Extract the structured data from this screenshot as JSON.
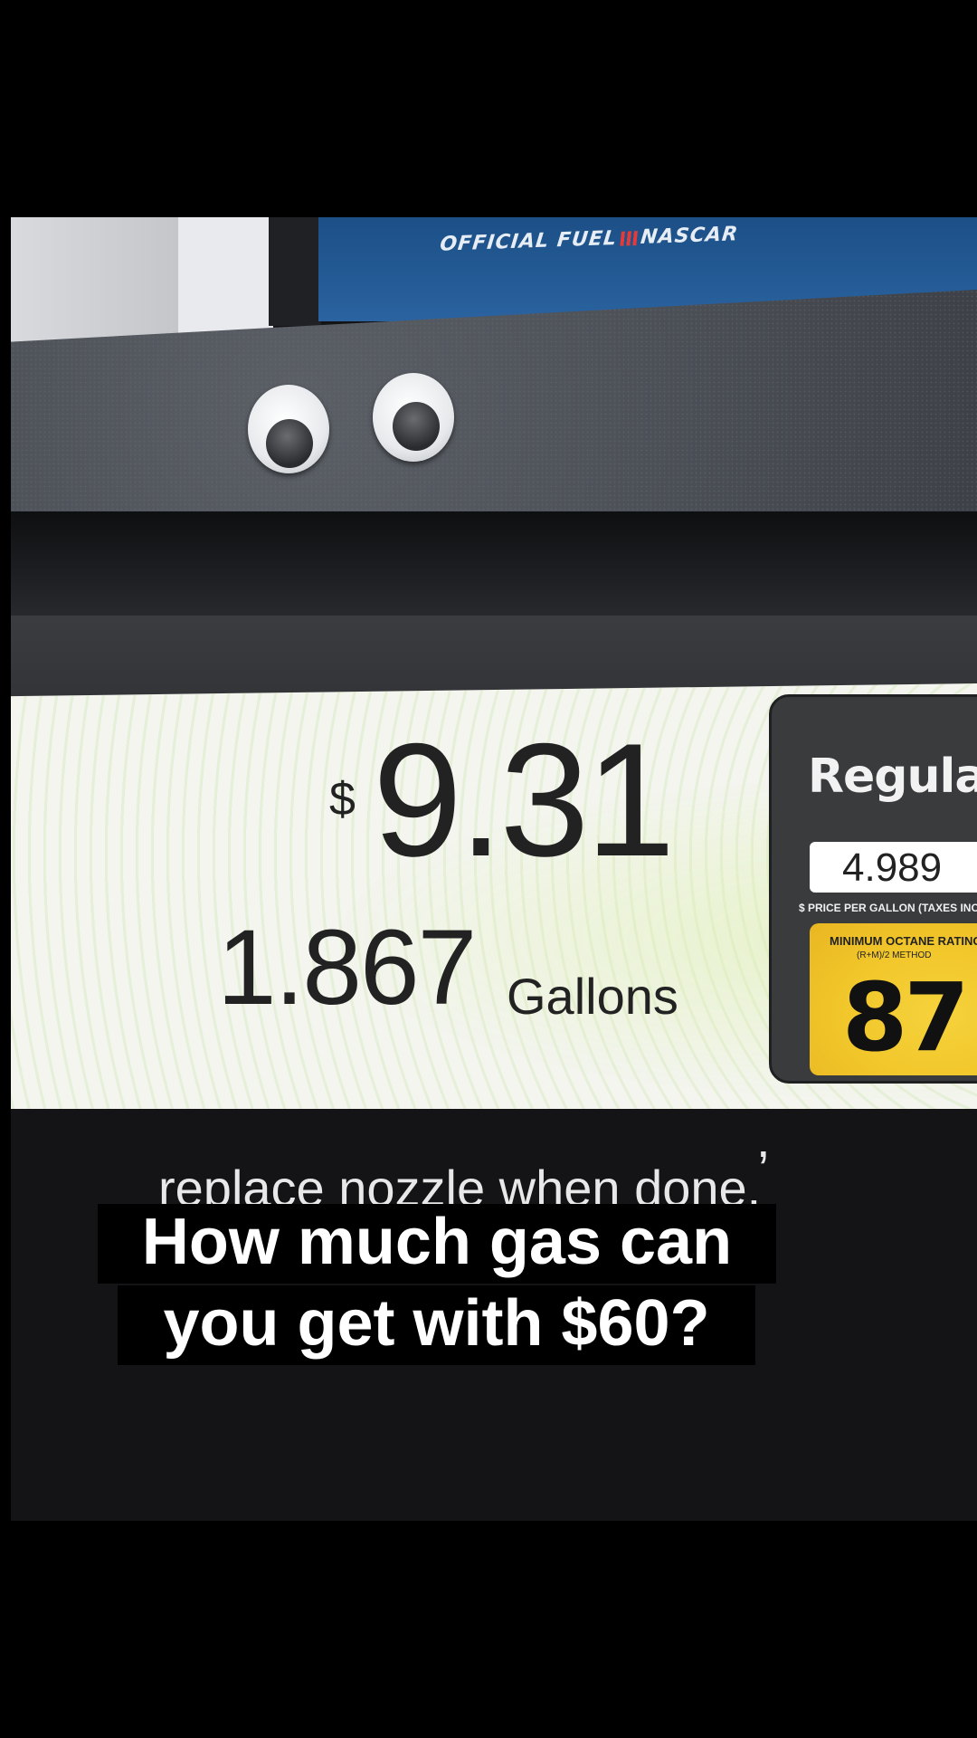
{
  "banner": {
    "left_text": "OFFICIAL FUEL",
    "right_text": "NASCAR"
  },
  "pump_screen": {
    "dollar_sign": "$",
    "sale_amount": "9.31",
    "gallons_value": "1.867",
    "gallons_label": "Gallons",
    "grade": {
      "name": "Regular",
      "price_per_gallon": "4.989",
      "price_label": "$ PRICE PER GALLON (TAXES INCLU",
      "octane_title": "MINIMUM OCTANE RATING",
      "octane_method": "(R+M)/2 METHOD",
      "octane_value": "87"
    }
  },
  "pump_instructions": {
    "line": "replace nozzle when done.",
    "comma": ","
  },
  "caption": {
    "line1": "How much gas can",
    "line2": "you get with $60?"
  },
  "colors": {
    "banner_blue": "#2a63a0",
    "octane_yellow": "#f1c62a",
    "screen_bg": "#f3f5ee"
  }
}
